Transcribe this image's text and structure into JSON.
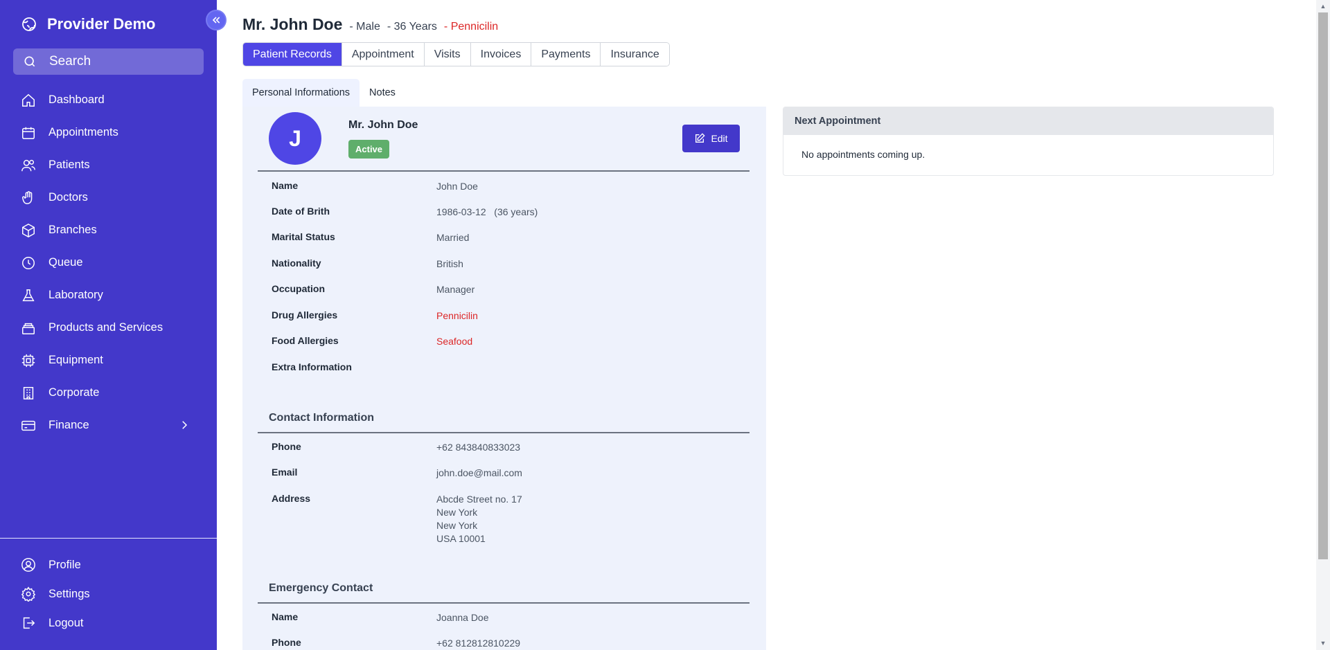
{
  "sidebar": {
    "brand": "Provider Demo",
    "search_label": "Search",
    "items": [
      {
        "label": "Dashboard",
        "icon": "home-icon"
      },
      {
        "label": "Appointments",
        "icon": "calendar-icon"
      },
      {
        "label": "Patients",
        "icon": "users-icon"
      },
      {
        "label": "Doctors",
        "icon": "hand-icon"
      },
      {
        "label": "Branches",
        "icon": "cube-icon"
      },
      {
        "label": "Queue",
        "icon": "clock-icon"
      },
      {
        "label": "Laboratory",
        "icon": "flask-icon"
      },
      {
        "label": "Products and Services",
        "icon": "stack-icon"
      },
      {
        "label": "Equipment",
        "icon": "chip-icon"
      },
      {
        "label": "Corporate",
        "icon": "building-icon"
      },
      {
        "label": "Finance",
        "icon": "card-icon"
      }
    ],
    "bottom_items": [
      {
        "label": "Profile",
        "icon": "user-circle-icon"
      },
      {
        "label": "Settings",
        "icon": "gear-icon"
      },
      {
        "label": "Logout",
        "icon": "logout-icon"
      }
    ]
  },
  "header": {
    "name": "Mr. John Doe",
    "gender": "- Male",
    "age": "- 36 Years",
    "allergy_prefix": "-",
    "allergy": "Pennicilin"
  },
  "top_tabs": [
    "Patient Records",
    "Appointment",
    "Visits",
    "Invoices",
    "Payments",
    "Insurance"
  ],
  "sub_tabs": [
    "Personal Informations",
    "Notes"
  ],
  "profile": {
    "initial": "J",
    "name": "Mr. John Doe",
    "status": "Active",
    "edit_label": "Edit"
  },
  "personal": [
    {
      "label": "Name",
      "value": "John Doe"
    },
    {
      "label": "Date of Brith",
      "value": "1986-03-12   (36 years)"
    },
    {
      "label": "Marital Status",
      "value": "Married"
    },
    {
      "label": "Nationality",
      "value": "British"
    },
    {
      "label": "Occupation",
      "value": "Manager"
    },
    {
      "label": "Drug Allergies",
      "value": "Pennicilin"
    },
    {
      "label": "Food Allergies",
      "value": "Seafood"
    },
    {
      "label": "Extra Information",
      "value": ""
    }
  ],
  "contact": {
    "title": "Contact Information",
    "rows": [
      {
        "label": "Phone",
        "value": "+62 843840833023"
      },
      {
        "label": "Email",
        "value": "john.doe@mail.com"
      },
      {
        "label": "Address",
        "value": "Abcde Street no. 17\nNew York\nNew York\nUSA 10001"
      }
    ]
  },
  "emergency": {
    "title": "Emergency Contact",
    "rows": [
      {
        "label": "Name",
        "value": "Joanna Doe"
      },
      {
        "label": "Phone",
        "value": "+62 812812810229"
      }
    ]
  },
  "next_appointment": {
    "title": "Next Appointment",
    "empty_text": "No appointments coming up."
  },
  "colors": {
    "sidebar": "#4338ca",
    "accent": "#4f46e5",
    "danger": "#dc2626",
    "success": "#5fae6b"
  }
}
